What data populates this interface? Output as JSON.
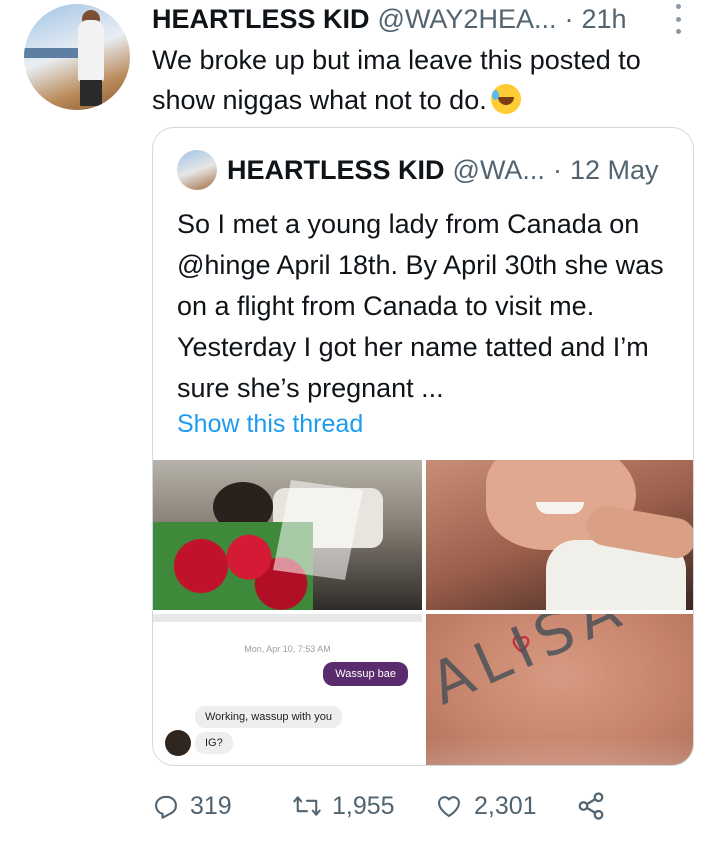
{
  "tweet": {
    "author_name": "HEARTLESS KID",
    "author_handle": "@WAY2HEA...",
    "separator": "·",
    "time": "21h",
    "text": "We broke up but ima leave this posted to show niggas what not to do.",
    "emoji": "rolling-on-floor-laughing-icon"
  },
  "quoted_tweet": {
    "author_name": "HEARTLESS KID",
    "author_handle": "@WA...",
    "separator": "·",
    "date": "12 May",
    "text": "So I met a young lady from Canada on @hinge April 18th. By April 30th she was on a flight from Canada to visit me. Yesterday I got her name tatted and I’m sure she’s pregnant ...",
    "show_thread": "Show this thread",
    "media": {
      "chat_screenshot": {
        "timestamp": "Mon, Apr 10, 7:53 AM",
        "outgoing": "Wassup bae",
        "incoming_1": "Working, wassup with you",
        "incoming_2": "IG?"
      },
      "tattoo_text": "ALISA"
    }
  },
  "actions": {
    "replies": "319",
    "retweets": "1,955",
    "likes": "2,301"
  },
  "colors": {
    "text": "#0f1419",
    "secondary": "#536471",
    "link": "#1d9bf0",
    "border": "#cfd9de"
  }
}
